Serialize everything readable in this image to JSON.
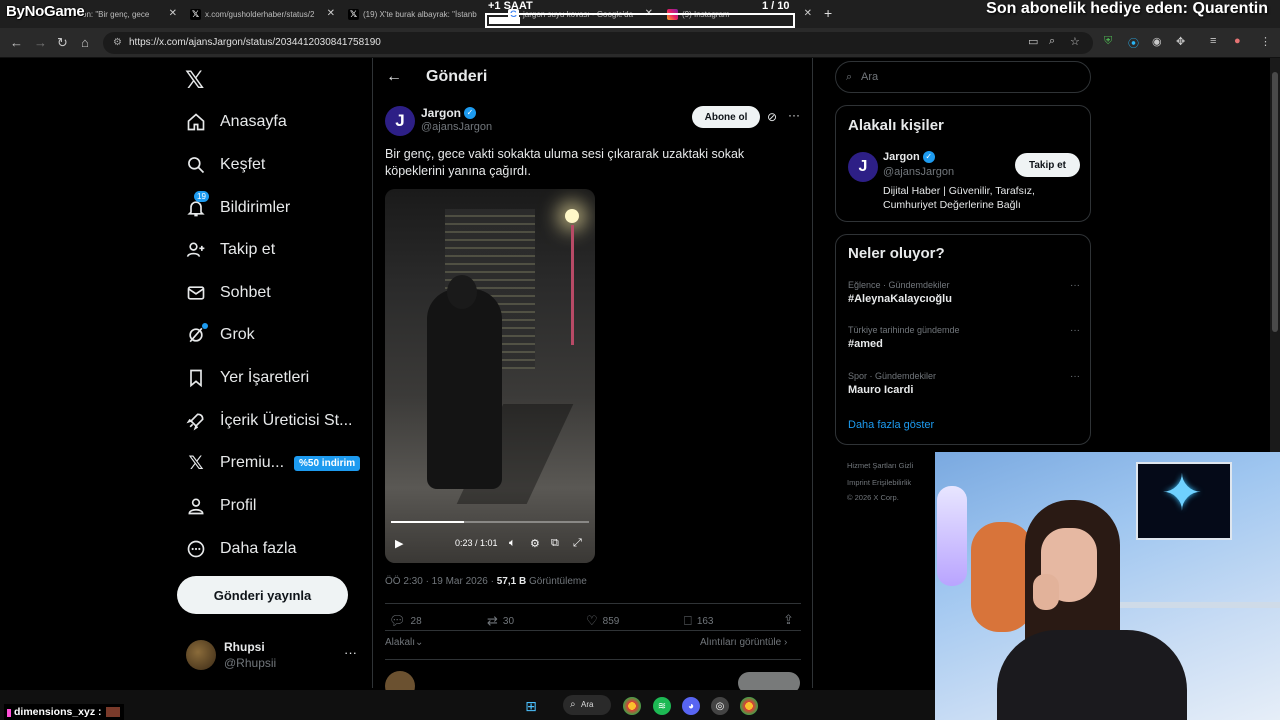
{
  "overlay": {
    "brand": "ByNoGame",
    "timer_left": "+1 SAAT",
    "timer_right": "1 / 10",
    "timer_progress": 0.1,
    "sub_banner": "Son abonelik hediye eden: Quarentin",
    "chat_user": "dimensions_xyz :"
  },
  "browser": {
    "tabs": [
      {
        "title": "on: \"Bir genç, gece",
        "icon": "x-icon"
      },
      {
        "title": "x.com/gusholderhaber/status/2",
        "icon": "x-icon"
      },
      {
        "title": "(19) X'te burak albayrak: \"İstanb",
        "icon": "x-icon"
      },
      {
        "title": "jargon suyu kovası - Google'da",
        "icon": "google-icon"
      },
      {
        "title": "(9) Instagram",
        "icon": "instagram-icon"
      }
    ],
    "url": "https://x.com/ajansJargon/status/2034412030841758190"
  },
  "nav": {
    "items": [
      {
        "label": "Anasayfa",
        "icon": "home-icon"
      },
      {
        "label": "Keşfet",
        "icon": "search-icon"
      },
      {
        "label": "Bildirimler",
        "icon": "bell-icon",
        "badge": "19"
      },
      {
        "label": "Takip et",
        "icon": "follow-icon"
      },
      {
        "label": "Sohbet",
        "icon": "mail-icon"
      },
      {
        "label": "Grok",
        "icon": "grok-icon"
      },
      {
        "label": "Yer İşaretleri",
        "icon": "bookmark-icon"
      },
      {
        "label": "İçerik Üreticisi St...",
        "icon": "rocket-icon"
      },
      {
        "label": "Premiu...",
        "icon": "x-icon",
        "promo": "%50 indirim"
      },
      {
        "label": "Profil",
        "icon": "person-icon"
      },
      {
        "label": "Daha fazla",
        "icon": "more-circle-icon"
      }
    ],
    "post_button": "Gönderi yayınla",
    "me_name": "Rhupsi",
    "me_handle": "@Rhupsii"
  },
  "post": {
    "header": "Gönderi",
    "author_name": "Jargon",
    "author_handle": "@ajansJargon",
    "subscribe": "Abone ol",
    "text": "Bir genç, gece vakti sokakta uluma sesi çıkararak uzaktaki sokak köpeklerini yanına çağırdı.",
    "video_time": "0:23 / 1:01",
    "video_progress": 0.37,
    "time": "ÖÖ 2:30 · 19 Mar 2026 ·",
    "views": "57,1 B",
    "views_label": "Görüntüleme",
    "replies": "28",
    "reposts": "30",
    "likes": "859",
    "bookmarks": "163",
    "related": "Alakalı",
    "quotes": "Alıntıları görüntüle"
  },
  "sidebar": {
    "search_placeholder": "Ara",
    "related_title": "Alakalı kişiler",
    "related_name": "Jargon",
    "related_handle": "@ajansJargon",
    "related_bio": "Dijital Haber | Güvenilir, Tarafsız, Cumhuriyet Değerlerine Bağlı",
    "follow": "Takip et",
    "trends_title": "Neler oluyor?",
    "trends": [
      {
        "category": "Eğlence · Gündemdekiler",
        "title": "#AleynaKalaycıoğlu"
      },
      {
        "category": "Türkiye tarihinde gündemde",
        "title": "#amed"
      },
      {
        "category": "Spor · Gündemdekiler",
        "title": "Mauro Icardi"
      }
    ],
    "show_more": "Daha fazla göster",
    "footer_1": "Hizmet Şartları   Gizli",
    "footer_2": "Imprint   Erişilebilirlik",
    "footer_3": "© 2026 X Corp."
  },
  "taskbar": {
    "search": "Ara"
  },
  "colors": {
    "accent": "#1d9bf0",
    "background": "#000000",
    "border": "#2f3336",
    "muted": "#71767b"
  }
}
